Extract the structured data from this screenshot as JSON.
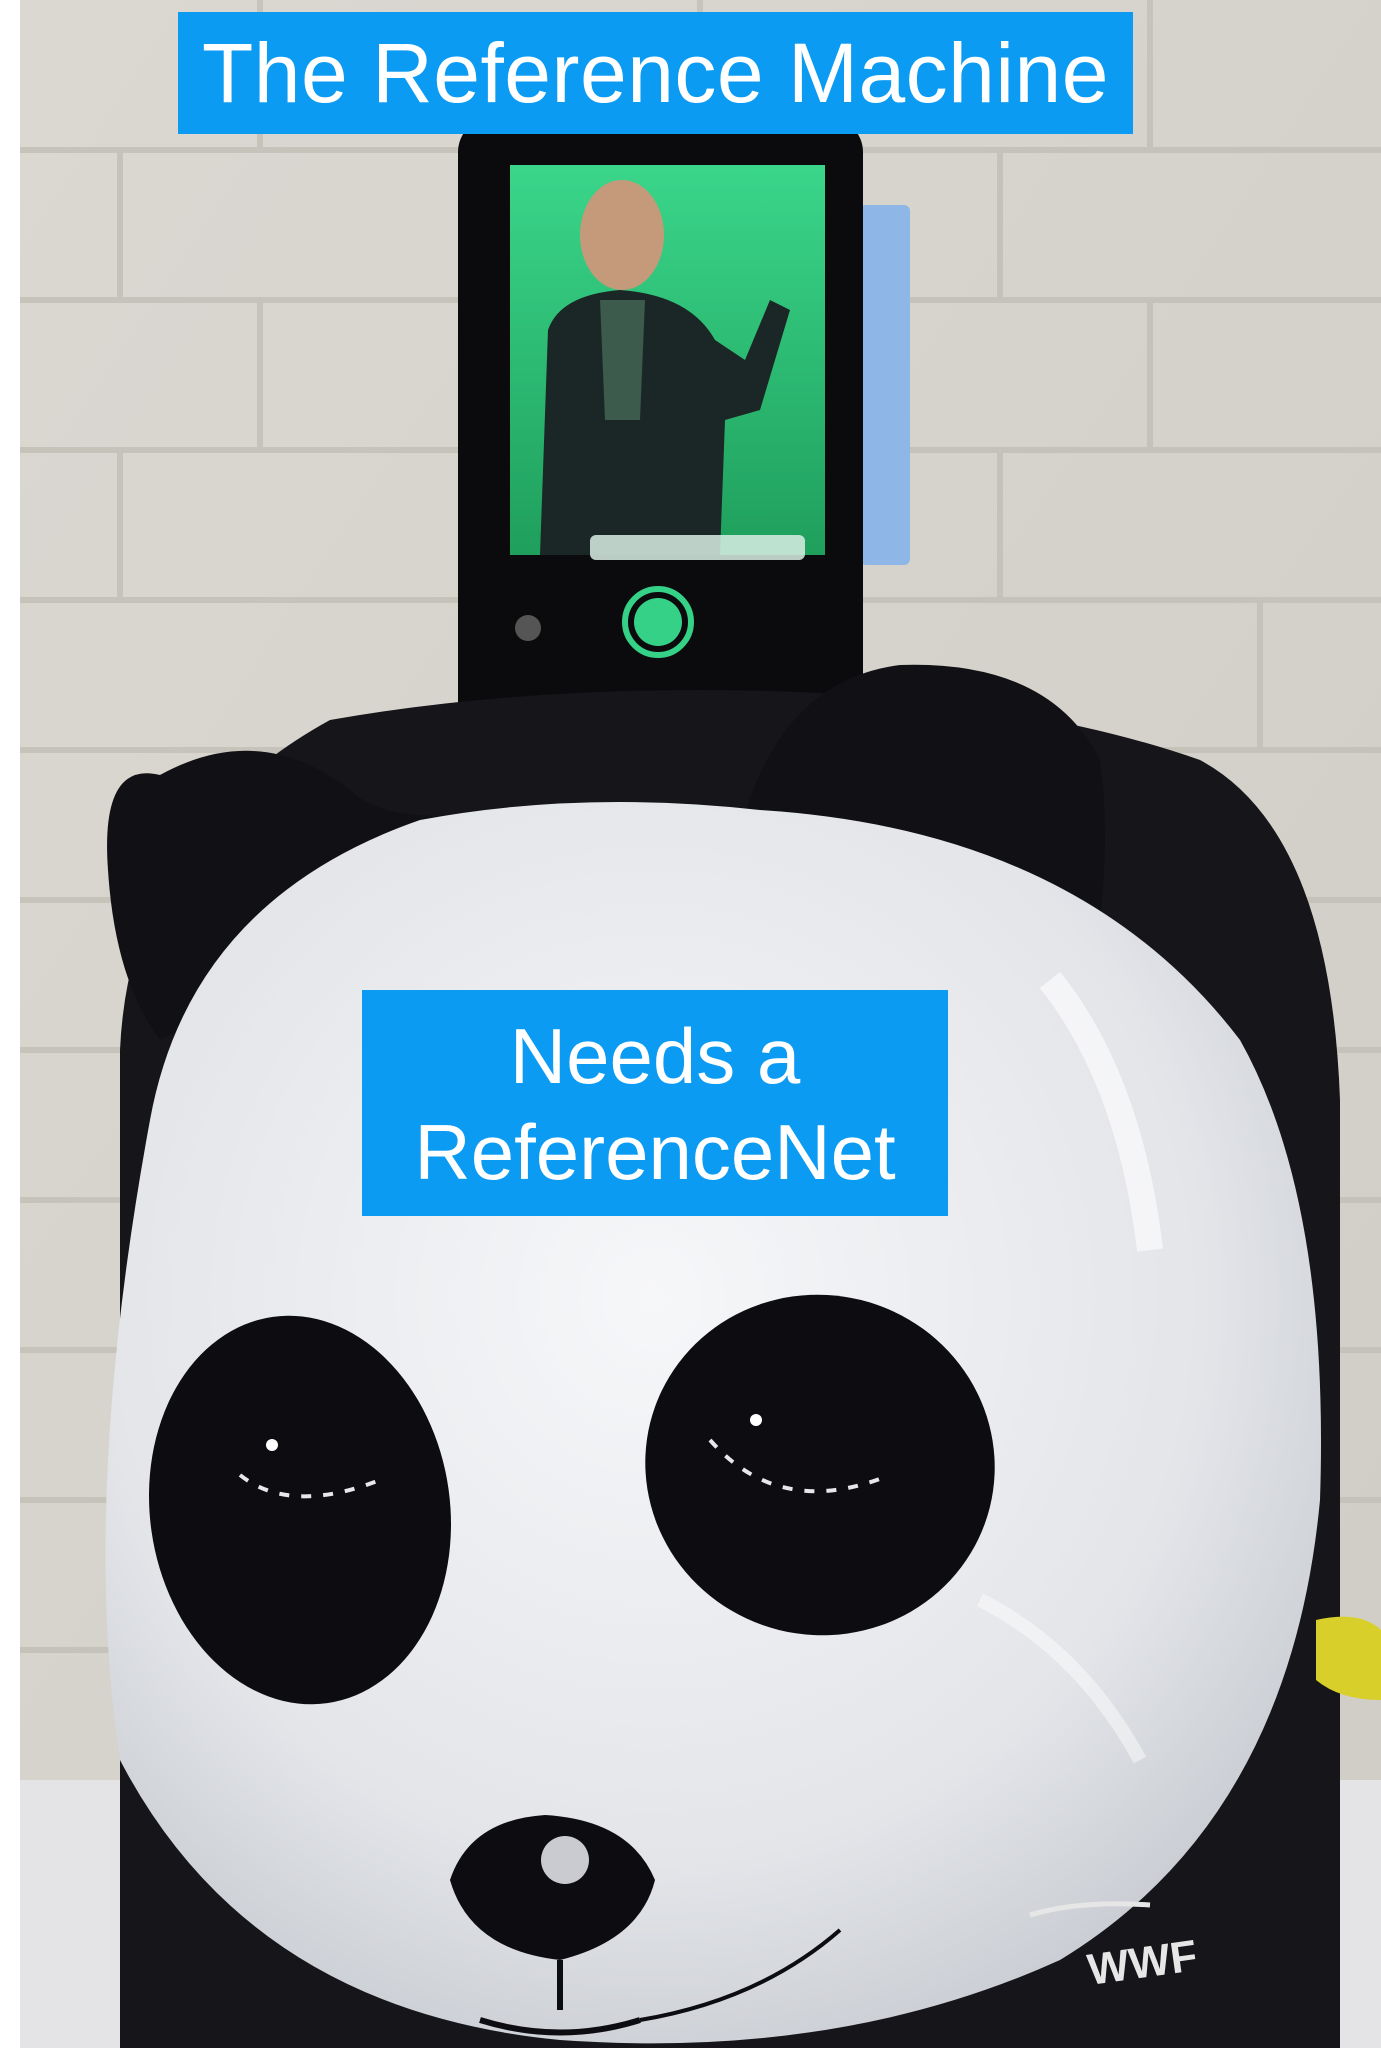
{
  "labels": {
    "title": "The Reference Machine",
    "subtitle_line1": "Needs a",
    "subtitle_line2": "ReferenceNet"
  },
  "decals": {
    "wwf_logo": "WWF"
  },
  "colors": {
    "label_background": "#0b9bf3",
    "label_text": "#ffffff",
    "wall": "#d9d7d0",
    "panda_white": "#ecedf0",
    "panda_black": "#121216",
    "phone_screen_green": "#2fc77a",
    "shutter_button": "#33d185"
  },
  "objects": [
    "brick-wall",
    "panda-figure",
    "smartphone",
    "phone-camera-preview",
    "shutter-button",
    "wwf-logo"
  ]
}
